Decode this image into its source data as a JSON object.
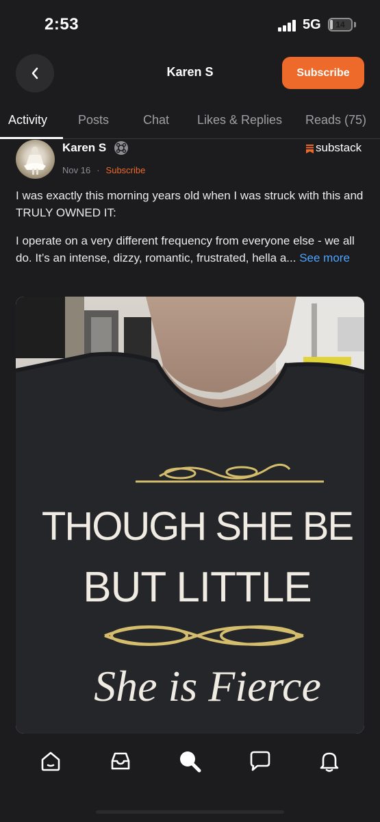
{
  "status_bar": {
    "time": "2:53",
    "network": "5G",
    "battery": "14",
    "battery_level": 0.14
  },
  "header": {
    "title": "Karen S",
    "subscribe_label": "Subscribe"
  },
  "tabs": [
    {
      "label": "Activity",
      "active": true
    },
    {
      "label": "Posts",
      "active": false
    },
    {
      "label": "Chat",
      "active": false
    },
    {
      "label": "Likes & Replies",
      "active": false
    },
    {
      "label": "Reads (75)",
      "active": false
    }
  ],
  "post": {
    "author": "Karen S",
    "brand": "substack",
    "date": "Nov 16",
    "separator": "·",
    "subscribe_label": "Subscribe",
    "paragraph1": "I was exactly this morning years old when I was struck with this and TRULY OWNED IT:",
    "paragraph2": "I operate on a very different frequency from everyone else - we all do. It’s an intense, dizzy, romantic, frustrated, hella a...",
    "see_more": "See more",
    "image": {
      "description_icon": "photo-shirt",
      "shirt_line1": "THOUGH SHE BE",
      "shirt_line2": "BUT LITTLE",
      "shirt_line3": "She is Fierce"
    }
  },
  "bottom_nav": [
    {
      "icon": "home-icon"
    },
    {
      "icon": "inbox-icon"
    },
    {
      "icon": "search-icon"
    },
    {
      "icon": "chat-icon"
    },
    {
      "icon": "bell-icon"
    }
  ],
  "colors": {
    "accent": "#ee6a2a",
    "link": "#4da3ff",
    "background": "#1c1c1e"
  }
}
